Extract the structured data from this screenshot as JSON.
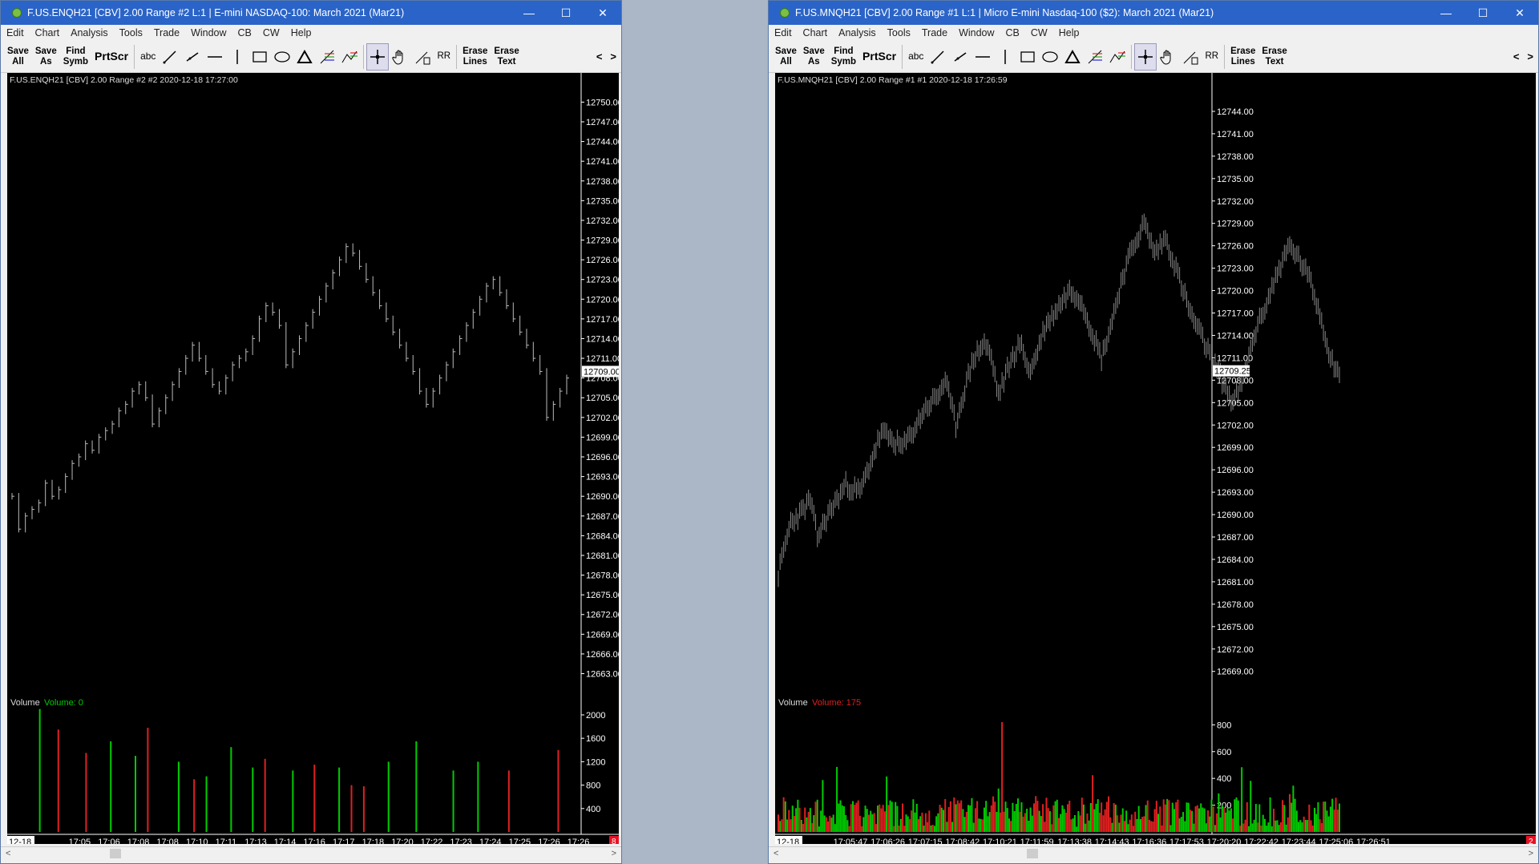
{
  "left": {
    "title": "F.US.ENQH21 [CBV]  2.00 Range  #2 L:1 | E-mini NASDAQ-100: March 2021 (Mar21)",
    "menu": [
      "Edit",
      "Chart",
      "Analysis",
      "Tools",
      "Trade",
      "Window",
      "CB",
      "CW",
      "Help"
    ],
    "toolbar": {
      "save_all": [
        "Save",
        "All"
      ],
      "save_as": [
        "Save",
        "As"
      ],
      "find_symb": [
        "Find",
        "Symb"
      ],
      "prtscr": "PrtScr",
      "abc": "abc",
      "rr": "RR",
      "erase_lines": [
        "Erase",
        "Lines"
      ],
      "erase_text": [
        "Erase",
        "Text"
      ],
      "prev": "<",
      "next": ">"
    },
    "chart_header": "F.US.ENQH21 [CBV]  2.00 Range  #2 #2 2020-12-18 17:27:00",
    "volume_label": "Volume",
    "volume_value": "Volume: 0",
    "volume_value_color": "#00cc00",
    "last_price": "12709.00",
    "x_labels": [
      "12-18",
      "17:05",
      "17:06",
      "17:08",
      "17:08",
      "17:10",
      "17:11",
      "17:13",
      "17:14",
      "17:16",
      "17:17",
      "17:18",
      "17:20",
      "17:22",
      "17:23",
      "17:24",
      "17:25",
      "17:26",
      "17:26"
    ],
    "badge": "8",
    "chart_data": {
      "type": "line",
      "subtype": "range-bars",
      "title": "",
      "xlabel": "",
      "ylabel": "",
      "ylim": [
        12660.5,
        12752.0
      ],
      "yticks": [
        12750,
        12747,
        12744,
        12741,
        12738,
        12735,
        12732,
        12729,
        12726,
        12723,
        12720,
        12717,
        12714,
        12711,
        12708,
        12705,
        12702,
        12699,
        12696,
        12693,
        12690,
        12687,
        12684,
        12681,
        12678,
        12675,
        12672,
        12669,
        12666,
        12663
      ],
      "price": [
        12690,
        12685,
        12687,
        12688,
        12689,
        12692,
        12690,
        12691,
        12693,
        12695,
        12696,
        12698,
        12697,
        12699,
        12700,
        12701,
        12703,
        12704,
        12706,
        12707,
        12705,
        12701,
        12703,
        12705,
        12707,
        12709,
        12711,
        12713,
        12711,
        12709,
        12707,
        12706,
        12708,
        12710,
        12711,
        12712,
        12714,
        12717,
        12719,
        12718,
        12716,
        12710,
        12712,
        12714,
        12716,
        12718,
        12720,
        12722,
        12724,
        12726,
        12728,
        12727,
        12725,
        12723,
        12721,
        12719,
        12717,
        12715,
        12713,
        12711,
        12709,
        12706,
        12704,
        12706,
        12708,
        12710,
        12712,
        12714,
        12716,
        12718,
        12720,
        12722,
        12723,
        12721,
        12719,
        12717,
        12715,
        12713,
        12711,
        12709,
        12702,
        12704,
        12706,
        12708
      ],
      "volume_ylim": [
        0,
        2150
      ],
      "volume_yticks": [
        2000,
        1600,
        1200,
        800,
        400
      ],
      "volume": [
        {
          "i": 9,
          "v": 2100,
          "c": "g"
        },
        {
          "i": 15,
          "v": 1750,
          "c": "r"
        },
        {
          "i": 24,
          "v": 1350,
          "c": "r"
        },
        {
          "i": 32,
          "v": 1550,
          "c": "g"
        },
        {
          "i": 40,
          "v": 1300,
          "c": "g"
        },
        {
          "i": 44,
          "v": 1780,
          "c": "r"
        },
        {
          "i": 54,
          "v": 1200,
          "c": "g"
        },
        {
          "i": 59,
          "v": 900,
          "c": "r"
        },
        {
          "i": 63,
          "v": 950,
          "c": "g"
        },
        {
          "i": 71,
          "v": 1450,
          "c": "g"
        },
        {
          "i": 78,
          "v": 1100,
          "c": "g"
        },
        {
          "i": 82,
          "v": 1250,
          "c": "r"
        },
        {
          "i": 91,
          "v": 1050,
          "c": "g"
        },
        {
          "i": 98,
          "v": 1150,
          "c": "r"
        },
        {
          "i": 106,
          "v": 1100,
          "c": "g"
        },
        {
          "i": 110,
          "v": 800,
          "c": "r"
        },
        {
          "i": 114,
          "v": 780,
          "c": "r"
        },
        {
          "i": 122,
          "v": 1200,
          "c": "g"
        },
        {
          "i": 131,
          "v": 1550,
          "c": "g"
        },
        {
          "i": 143,
          "v": 1050,
          "c": "g"
        },
        {
          "i": 151,
          "v": 1200,
          "c": "g"
        },
        {
          "i": 161,
          "v": 1050,
          "c": "r"
        },
        {
          "i": 177,
          "v": 1400,
          "c": "r"
        }
      ]
    }
  },
  "right": {
    "title": "F.US.MNQH21 [CBV]  2.00 Range  #1 L:1 | Micro E-mini Nasdaq-100 ($2): March 2021 (Mar21)",
    "menu": [
      "Edit",
      "Chart",
      "Analysis",
      "Tools",
      "Trade",
      "Window",
      "CB",
      "CW",
      "Help"
    ],
    "toolbar": {
      "save_all": [
        "Save",
        "All"
      ],
      "save_as": [
        "Save",
        "As"
      ],
      "find_symb": [
        "Find",
        "Symb"
      ],
      "prtscr": "PrtScr",
      "abc": "abc",
      "rr": "RR",
      "erase_lines": [
        "Erase",
        "Lines"
      ],
      "erase_text": [
        "Erase",
        "Text"
      ],
      "prev": "<",
      "next": ">"
    },
    "chart_header": "F.US.MNQH21 [CBV]  2.00 Range  #1 #1 2020-12-18 17:26:59",
    "volume_label": "Volume",
    "volume_value": "Volume: 175",
    "volume_value_color": "#e02020",
    "last_price": "12709.25",
    "x_labels": [
      "12-18",
      "17:05:47",
      "17:06:26",
      "17:07:15",
      "17:08:42",
      "17:10:21",
      "17:11:59",
      "17:13:38",
      "17:14:43",
      "17:16:36",
      "17:17:53",
      "17:20:20",
      "17:22:42",
      "17:23:44",
      "17:25:06",
      "17:26:51"
    ],
    "badge": "2",
    "chart_data": {
      "type": "line",
      "subtype": "range-bars",
      "title": "",
      "xlabel": "",
      "ylabel": "",
      "ylim": [
        12666.5,
        12747.0
      ],
      "yticks": [
        12744,
        12741,
        12738,
        12735,
        12732,
        12729,
        12726,
        12723,
        12720,
        12717,
        12714,
        12711,
        12708,
        12705,
        12702,
        12699,
        12696,
        12693,
        12690,
        12687,
        12684,
        12681,
        12678,
        12675,
        12672,
        12669
      ],
      "keypoints": [
        [
          0,
          12682
        ],
        [
          7,
          12689
        ],
        [
          12,
          12690
        ],
        [
          18,
          12692
        ],
        [
          22,
          12687
        ],
        [
          28,
          12690
        ],
        [
          38,
          12694
        ],
        [
          46,
          12693
        ],
        [
          52,
          12697
        ],
        [
          58,
          12701
        ],
        [
          64,
          12700
        ],
        [
          70,
          12699
        ],
        [
          78,
          12702
        ],
        [
          82,
          12704
        ],
        [
          90,
          12706
        ],
        [
          94,
          12708
        ],
        [
          100,
          12702
        ],
        [
          104,
          12706
        ],
        [
          110,
          12711
        ],
        [
          116,
          12713
        ],
        [
          120,
          12711
        ],
        [
          124,
          12706
        ],
        [
          130,
          12710
        ],
        [
          136,
          12713
        ],
        [
          142,
          12709
        ],
        [
          150,
          12715
        ],
        [
          158,
          12718
        ],
        [
          164,
          12720
        ],
        [
          170,
          12719
        ],
        [
          176,
          12715
        ],
        [
          182,
          12711
        ],
        [
          188,
          12716
        ],
        [
          194,
          12722
        ],
        [
          200,
          12726
        ],
        [
          206,
          12729
        ],
        [
          212,
          12725
        ],
        [
          218,
          12727
        ],
        [
          224,
          12723
        ],
        [
          232,
          12717
        ],
        [
          240,
          12713
        ],
        [
          248,
          12709
        ],
        [
          256,
          12705
        ],
        [
          262,
          12708
        ],
        [
          268,
          12714
        ],
        [
          276,
          12719
        ],
        [
          282,
          12723
        ],
        [
          288,
          12726
        ],
        [
          294,
          12724
        ],
        [
          300,
          12721
        ],
        [
          306,
          12716
        ],
        [
          311,
          12711
        ],
        [
          316,
          12709
        ]
      ],
      "volume_ylim": [
        0,
        880
      ],
      "volume_yticks": [
        800,
        600,
        400,
        200
      ]
    }
  }
}
